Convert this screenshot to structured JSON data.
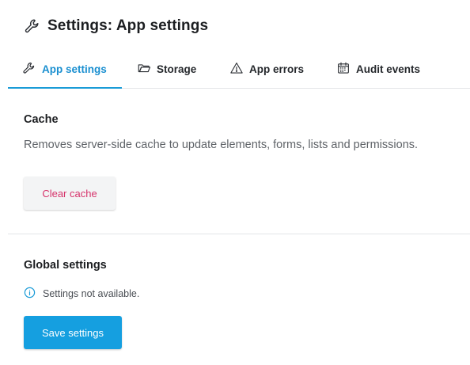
{
  "header": {
    "title": "Settings: App settings",
    "icon": "wrench-icon"
  },
  "tabs": [
    {
      "label": "App settings",
      "icon": "wrench-icon",
      "active": true
    },
    {
      "label": "Storage",
      "icon": "folder-icon",
      "active": false
    },
    {
      "label": "App errors",
      "icon": "warning-icon",
      "active": false
    },
    {
      "label": "Audit events",
      "icon": "calendar-icon",
      "active": false
    }
  ],
  "cache": {
    "title": "Cache",
    "description": "Removes server-side cache to update elements, forms, lists and permissions.",
    "button_label": "Clear cache"
  },
  "global": {
    "title": "Global settings",
    "info_icon": "info-icon",
    "info_text": "Settings not available.",
    "button_label": "Save settings"
  },
  "colors": {
    "accent": "#1a9bd7",
    "danger_text": "#d6326a",
    "primary_button": "#159fe0"
  }
}
